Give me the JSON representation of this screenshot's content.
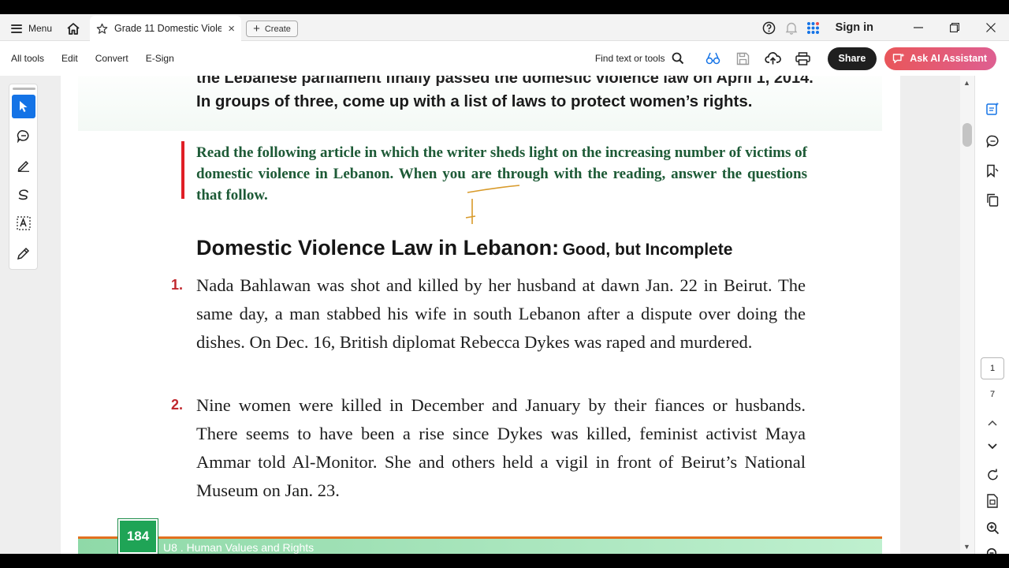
{
  "titlebar": {
    "menu_label": "Menu",
    "tab_title": "Grade 11 Domestic Viole...",
    "tab_close": "×",
    "create_label": "Create",
    "create_plus": "+",
    "sign_in": "Sign in"
  },
  "toolbar": {
    "left_items": [
      "All tools",
      "Edit",
      "Convert",
      "E-Sign"
    ],
    "find_label": "Find text or tools",
    "share_label": "Share",
    "ai_label": "Ask AI Assistant"
  },
  "document": {
    "cut_line": "the Lebanese parliament finally passed the domestic violence law on April 1, 2014.",
    "groups_line": "In groups of three, come up with a list of laws to protect women’s rights.",
    "instruction": "Read the following article in which the writer sheds light on the increasing number of victims of domestic violence in Lebanon. When you are through with the reading, answer the questions that follow.",
    "heading_main": "Domestic Violence Law in Lebanon:",
    "heading_sub": "Good, but Incomplete",
    "paragraphs": [
      {
        "num": "1.",
        "text": "Nada Bahlawan was shot and killed by her husband at dawn Jan. 22 in Beirut. The same day, a man stabbed his wife in south Lebanon after a dispute over doing the dishes. On Dec. 16, British diplomat Rebecca Dykes was raped and murdered."
      },
      {
        "num": "2.",
        "text": "Nine women were killed in December and January by their fiances or husbands. There seems to have been a rise since Dykes was killed, feminist activist Maya Ammar told Al-Monitor. She and others held a vigil in front of Beirut’s National Museum on Jan. 23."
      }
    ],
    "page_number": "184",
    "footer_text": "U8 . Human Values and Rights"
  },
  "navigation": {
    "current_page": "1",
    "total_pages": "7"
  },
  "colors": {
    "accent": "#1473e6",
    "instruction_green": "#1d5a36",
    "number_red": "#c0272d",
    "ai_gradient_start": "#e9565a",
    "badge_green": "#1fa456"
  }
}
